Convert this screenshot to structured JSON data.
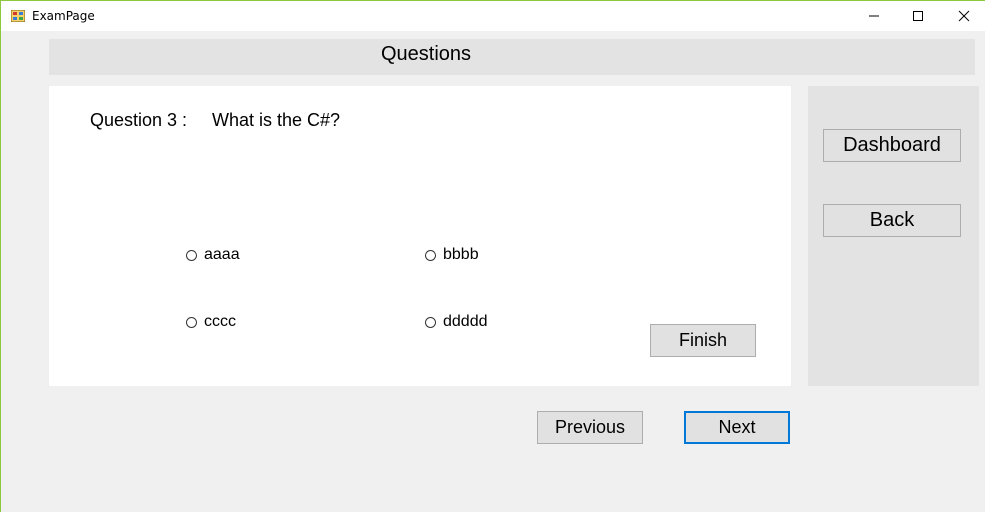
{
  "window": {
    "title": "ExamPage",
    "controls": {
      "minimize": "minimize",
      "maximize": "maximize",
      "close": "close"
    }
  },
  "header": {
    "title": "Questions"
  },
  "question": {
    "label": "Question 3 :",
    "text": "What is the C#?",
    "options": [
      {
        "label": "aaaa",
        "selected": false
      },
      {
        "label": "bbbb",
        "selected": false
      },
      {
        "label": "cccc",
        "selected": false
      },
      {
        "label": "ddddd",
        "selected": false
      }
    ],
    "finish_label": "Finish"
  },
  "side": {
    "dashboard_label": "Dashboard",
    "back_label": "Back"
  },
  "nav": {
    "previous_label": "Previous",
    "next_label": "Next"
  },
  "colors": {
    "accent_focus": "#0078d7",
    "button_face": "#e1e1e1",
    "panel": "#e3e3e3"
  },
  "icons": {
    "app": "app-icon",
    "minimize": "minimize-icon",
    "maximize": "maximize-icon",
    "close": "close-icon"
  }
}
